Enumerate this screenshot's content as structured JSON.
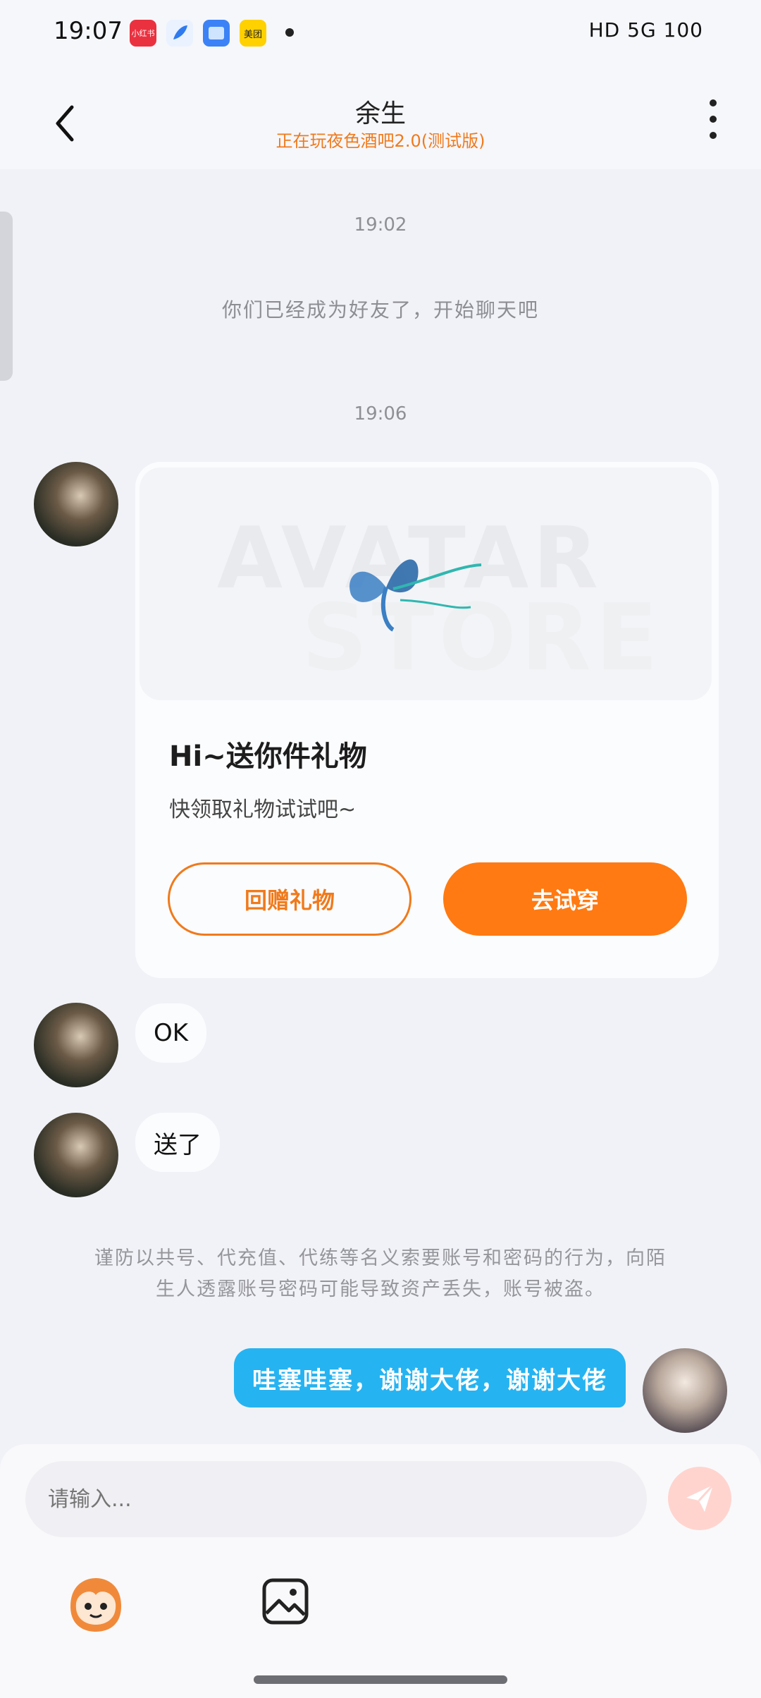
{
  "status_bar": {
    "time": "19:07",
    "app_icons": [
      "小红书",
      "",
      "",
      "美团"
    ],
    "right_text": "HD 5G 100"
  },
  "header": {
    "contact_name": "余生",
    "contact_status": "正在玩夜色酒吧2.0(测试版)"
  },
  "chat": {
    "time_1": "19:02",
    "system_message": "你们已经成为好友了，开始聊天吧",
    "time_2": "19:06",
    "gift_card": {
      "banner_word_1": "AVATAR",
      "banner_word_2": "STORE",
      "title": "Hi~送你件礼物",
      "subtitle": "快领取礼物试试吧~",
      "return_gift_label": "回赠礼物",
      "try_on_label": "去试穿"
    },
    "friend_messages": [
      "OK",
      "送了"
    ],
    "warning_line_1": "谨防以共号、代充值、代练等名义索要账号和密码的行为，向陌",
    "warning_line_2": "生人透露账号密码可能导致资产丢失，账号被盗。",
    "my_message": "哇塞哇塞，谢谢大佬，谢谢大佬"
  },
  "input": {
    "placeholder": "请输入..."
  },
  "colors": {
    "accent_orange": "#ff7a12",
    "bubble_blue": "#26b3f1"
  }
}
